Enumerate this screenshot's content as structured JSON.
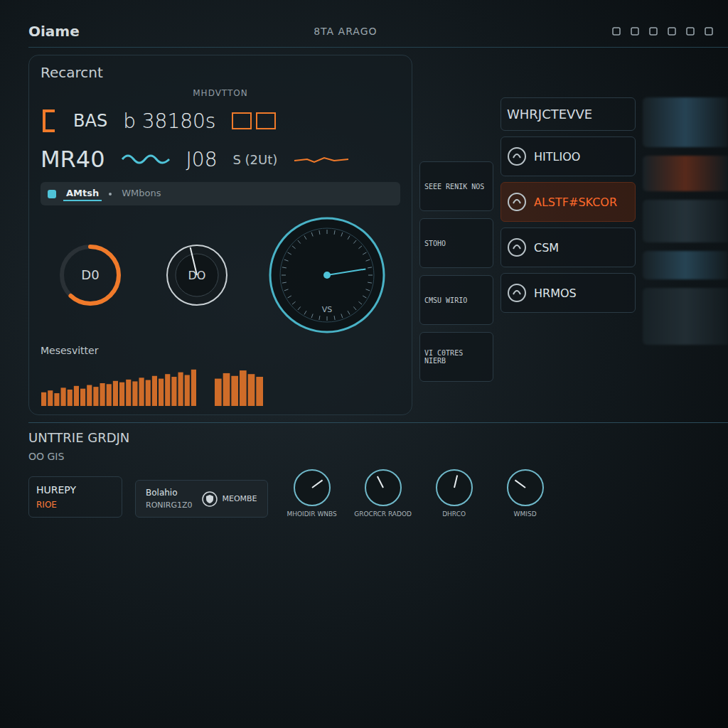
{
  "header": {
    "title": "Oiame",
    "center": "8TA ARAGO"
  },
  "overview": {
    "title": "Recarcnt",
    "subtitle": "MHDVTTON"
  },
  "primary_stat": {
    "code": "BAS",
    "value": "b 38180s"
  },
  "secondary_stat": {
    "code": "MR40",
    "value": "J08",
    "note": "S (2Ut)"
  },
  "tabs": [
    {
      "label": "AMtsh",
      "selected": true
    },
    {
      "label": "WMbons",
      "selected": false
    }
  ],
  "gauges": [
    {
      "kind": "ring",
      "label": "D0",
      "level": 0.62
    },
    {
      "kind": "knob",
      "label": "DO",
      "level": 0.45
    },
    {
      "kind": "dial",
      "label": "VS",
      "level": 0.8
    }
  ],
  "chart": {
    "title": "Mesesvitter",
    "series": [
      {
        "values": [
          30,
          34,
          28,
          40,
          36,
          44,
          38,
          46,
          42,
          50,
          48,
          55,
          52,
          58,
          54,
          62,
          57,
          66,
          60,
          70,
          64,
          74,
          68,
          80
        ]
      },
      {
        "values": [
          60,
          72,
          66,
          78,
          70,
          64
        ]
      }
    ]
  },
  "feed": [
    {
      "title": "SEEE RENIK NOS"
    },
    {
      "title": "STOHO"
    },
    {
      "title": "CMSU WIRIO"
    },
    {
      "title": "VI C0TRES NIERB"
    }
  ],
  "monitor": {
    "title": "WHRJCTEVVE",
    "rows": [
      {
        "label": "HITLIOO",
        "alert": false
      },
      {
        "label": "ALSTF#SKCOR",
        "alert": true
      },
      {
        "label": "CSM",
        "alert": false
      },
      {
        "label": "HRMOS",
        "alert": false
      }
    ]
  },
  "bottom": {
    "title": "UNTTRIE GRDJN",
    "sub": "OO GIS",
    "cards": [
      {
        "label": "HUREPY",
        "value": "RIOE"
      }
    ],
    "center": {
      "title": "Bolahio",
      "sub": "RONIRG1Z0",
      "badge": "MEOMBE"
    },
    "dials": [
      {
        "label": "MHOIDIR WNBS",
        "level": 0.7
      },
      {
        "label": "GROCRCR RADOD",
        "level": 0.4
      },
      {
        "label": "DHRCO",
        "level": 0.55
      },
      {
        "label": "WMISD",
        "level": 0.3
      }
    ]
  }
}
